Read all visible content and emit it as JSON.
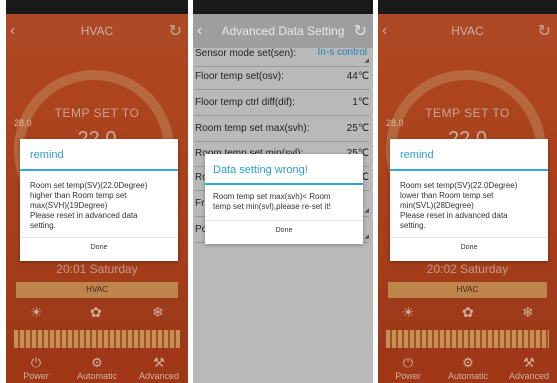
{
  "phone1": {
    "title": "HVAC",
    "temp_set_label": "TEMP SET TO",
    "temp_value": "22.0",
    "scale_min": "28.0",
    "datetime": "20:01 Saturday",
    "mode_label": "HVAC",
    "nav": [
      "Power",
      "Automatic",
      "Advanced"
    ],
    "dialog": {
      "title": "remind",
      "message": "Room set temp(SV)(22.0Degree)\nhigher than Room temp set\nmax(SVH)(19Degree)\nPlease reset in advanced data\nsetting.",
      "button": "Done"
    }
  },
  "phone2": {
    "title": "Advanced Data Setting",
    "rows": [
      {
        "label": "Sensor mode set(sen):",
        "value": "In-s control"
      },
      {
        "label": "Floor temp set(osv):",
        "value": "44℃"
      },
      {
        "label": "Floor temp ctrl diff(dif):",
        "value": "1℃"
      },
      {
        "label": "Room temp set max(svh):",
        "value": "25℃"
      },
      {
        "label": "Room temp set min(svl):",
        "value": "25℃"
      },
      {
        "label": "Ro",
        "value": "0℃"
      },
      {
        "label": "Fro",
        "value": ""
      },
      {
        "label": "Po",
        "value": ""
      }
    ],
    "dialog": {
      "title": "Data setting wrong!",
      "message": "Room temp set max(svh)< Room\ntemp set min(svl),please re-set it!",
      "button": "Done"
    }
  },
  "phone3": {
    "title": "HVAC",
    "temp_set_label": "TEMP SET TO",
    "temp_value": "22.0",
    "scale_min": "28.0",
    "datetime": "20:02 Saturday",
    "mode_label": "HVAC",
    "nav": [
      "Power",
      "Automatic",
      "Advanced"
    ],
    "dialog": {
      "title": "remind",
      "message": "Room set temp(SV)(22.0Degree)\nlower than Room temp set\nmin(SVL)(28Degree)\nPlease reset in advanced data\nsetting.",
      "button": "Done"
    }
  },
  "icons": {
    "back": "chevron-left-icon",
    "refresh": "refresh-icon",
    "power": "power-icon",
    "automatic": "auto-icon",
    "advanced": "wrench-icon",
    "snow": "snowflake-icon"
  },
  "colors": {
    "hvac_bg": "#d8582a",
    "accent": "#2fa9d9",
    "adv_bg": "#b9b9b9"
  }
}
